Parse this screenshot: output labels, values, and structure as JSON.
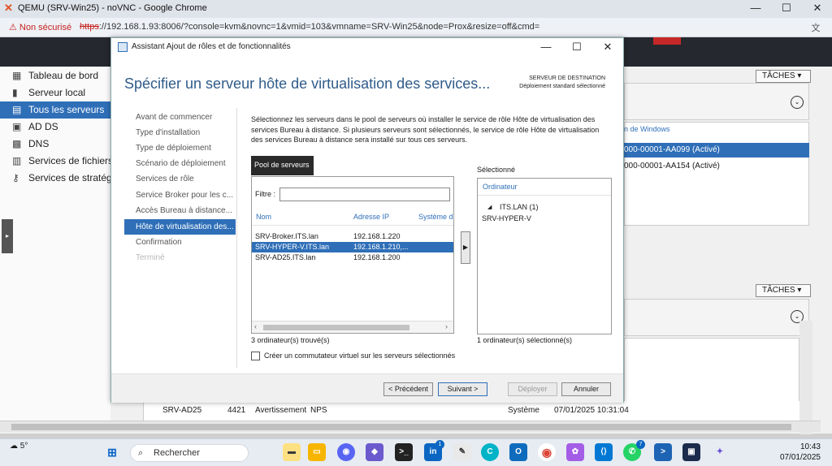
{
  "browser": {
    "window_title": "QEMU (SRV-Win25) - noVNC - Google Chrome",
    "security_label": "Non sécurisé",
    "url_scheme": "https",
    "url_rest": "://192.168.1.93:8006/?console=kvm&novnc=1&vmid=103&vmname=SRV-Win25&node=Prox&resize=off&cmd="
  },
  "server_manager": {
    "nav": [
      {
        "label": "Tableau de bord",
        "icon": "dashboard-icon"
      },
      {
        "label": "Serveur local",
        "icon": "server-icon"
      },
      {
        "label": "Tous les serveurs",
        "icon": "servers-icon",
        "selected": true
      },
      {
        "label": "AD DS",
        "icon": "ad-icon"
      },
      {
        "label": "DNS",
        "icon": "dns-icon"
      },
      {
        "label": "Services de fichiers et",
        "icon": "files-icon"
      },
      {
        "label": "Services de stratégie",
        "icon": "policy-icon"
      }
    ],
    "tasks_label": "TÂCHES",
    "license_header": "n de Windows",
    "license_rows": [
      "000-00001-AA099 (Activé)",
      "000-00001-AA154 (Activé)"
    ],
    "event_row": {
      "server": "SRV-AD25",
      "id": "4421",
      "level": "Avertissement",
      "source": "NPS",
      "log": "Système",
      "date": "07/01/2025 10:31:04"
    }
  },
  "dialog": {
    "title": "Assistant Ajout de rôles et de fonctionnalités",
    "heading": "Spécifier un serveur hôte de virtualisation des services...",
    "destination_title": "SERVEUR DE DESTINATION",
    "destination_value": "Déploiement standard sélectionné",
    "steps": [
      {
        "label": "Avant de commencer",
        "state": "normal"
      },
      {
        "label": "Type d'installation",
        "state": "normal"
      },
      {
        "label": "Type de déploiement",
        "state": "normal"
      },
      {
        "label": "Scénario de déploiement",
        "state": "normal"
      },
      {
        "label": "Services de rôle",
        "state": "normal"
      },
      {
        "label": "Service Broker pour les c...",
        "state": "normal"
      },
      {
        "label": "Accès Bureau à distance...",
        "state": "normal"
      },
      {
        "label": "Hôte de virtualisation des...",
        "state": "current"
      },
      {
        "label": "Confirmation",
        "state": "normal"
      },
      {
        "label": "Terminé",
        "state": "disabled"
      }
    ],
    "description": "Sélectionnez les serveurs dans le pool de serveurs où installer le service de rôle Hôte de virtualisation des services Bureau à distance. Si plusieurs serveurs sont sélectionnés, le service de rôle Hôte de virtualisation des services Bureau à distance sera installé sur tous ces serveurs.",
    "pool_tab": "Pool de serveurs",
    "filter_label": "Filtre :",
    "filter_value": "",
    "columns": [
      "Nom",
      "Adresse IP",
      "Système d"
    ],
    "servers": [
      {
        "name": "SRV-Broker.ITS.lan",
        "ip": "192.168.1.220",
        "selected": false
      },
      {
        "name": "SRV-HYPER-V.ITS.lan",
        "ip": "192.168.1.210,...",
        "selected": true
      },
      {
        "name": "SRV-AD25.ITS.lan",
        "ip": "192.168.1.200",
        "selected": false
      }
    ],
    "found_count": "3 ordinateur(s) trouvé(s)",
    "selected_label": "Sélectionné",
    "selected_column": "Ordinateur",
    "selected_group": "ITS.LAN (1)",
    "selected_server": "SRV-HYPER-V",
    "selected_count": "1 ordinateur(s) sélectionné(s)",
    "switch_label": "Créer un commutateur virtuel sur les serveurs sélectionnés",
    "switch_checked": false,
    "buttons": {
      "previous": "< Précédent",
      "next": "Suivant >",
      "deploy": "Déployer",
      "cancel": "Annuler"
    }
  },
  "taskbar": {
    "weather": "5°",
    "search_placeholder": "Rechercher",
    "time": "10:43",
    "date": "07/01/2025",
    "badges": {
      "linkedin": "1",
      "whatsapp": "7"
    }
  }
}
